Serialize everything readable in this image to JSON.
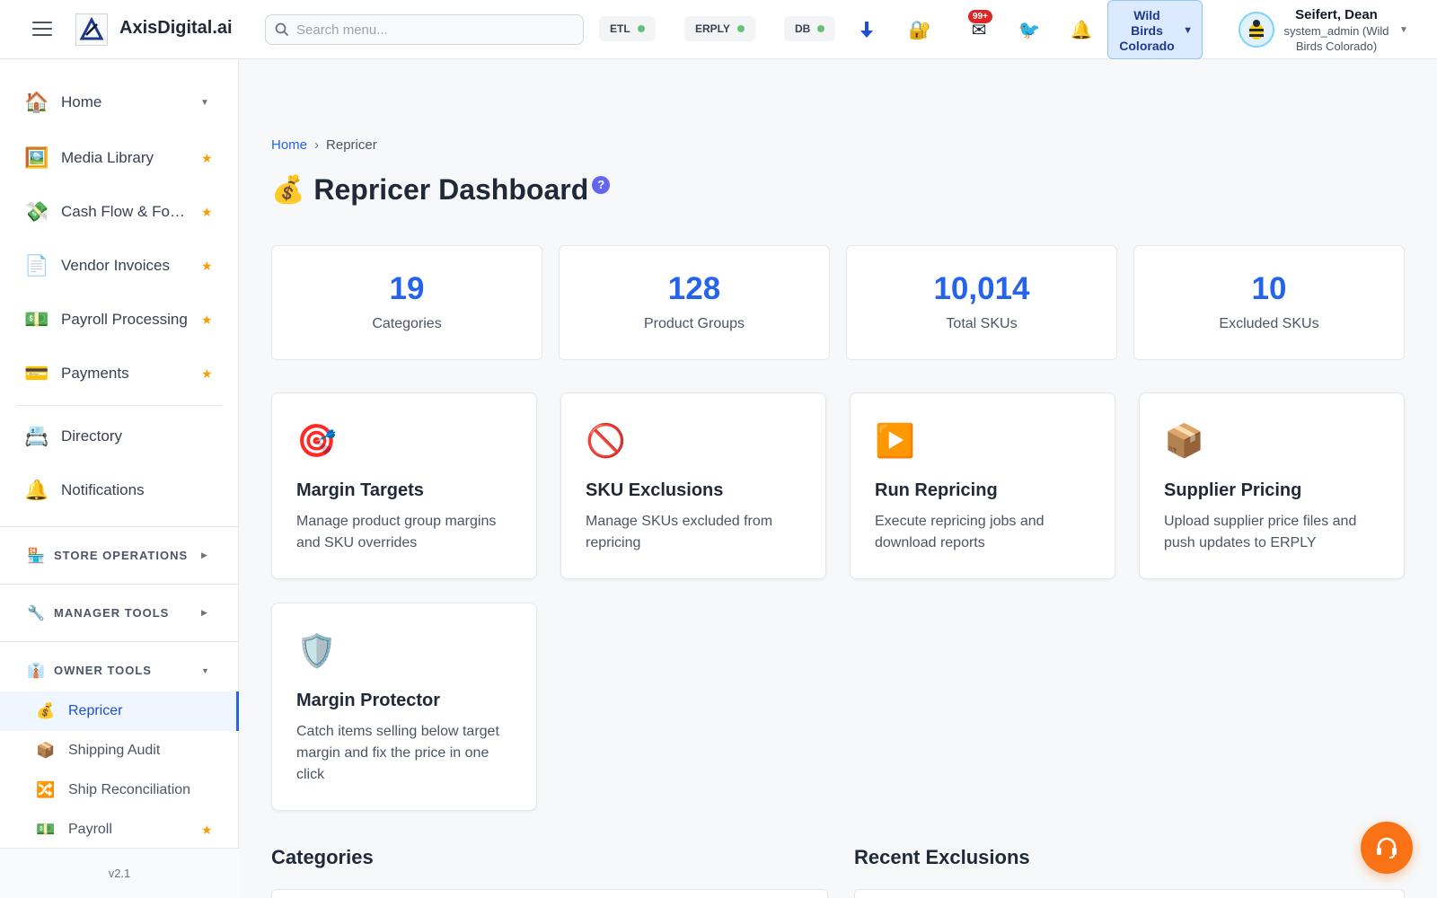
{
  "header": {
    "app_title": "AxisDigital.ai",
    "search_placeholder": "Search menu...",
    "status": [
      {
        "label": "ETL",
        "color": "#6ac07a"
      },
      {
        "label": "ERPLY",
        "color": "#6ac07a"
      },
      {
        "label": "DB",
        "color": "#6ac07a"
      }
    ],
    "icons": [
      "download-icon",
      "lock-icon",
      "mail-icon",
      "bird-icon",
      "bell-icon"
    ],
    "mail_badge": "99+",
    "store_line1": "Wild",
    "store_line2": "Birds",
    "store_line3": "Colorado",
    "user_name": "Seifert, Dean",
    "user_role_line1": "system_admin (Wild",
    "user_role_line2": "Birds Colorado)"
  },
  "sidebar": {
    "items": [
      {
        "label": "Home",
        "icon": "house-icon"
      },
      {
        "label": "Media Library",
        "icon": "picture-icon"
      },
      {
        "label": "Cash Flow & Forecast",
        "icon": "money-wings-icon"
      },
      {
        "label": "Vendor Invoices",
        "icon": "document-icon"
      },
      {
        "label": "Payroll Processing",
        "icon": "dollar-bill-icon"
      },
      {
        "label": "Payments",
        "icon": "credit-card-icon"
      },
      {
        "label": "Directory",
        "icon": "card-index-icon"
      },
      {
        "label": "Notifications",
        "icon": "bell-icon"
      }
    ],
    "sections": [
      {
        "label": "STORE OPERATIONS",
        "icon": "store-icon"
      },
      {
        "label": "MANAGER TOOLS",
        "icon": "wrench-icon"
      },
      {
        "label": "OWNER TOOLS",
        "icon": "necktie-icon"
      }
    ],
    "owner_items": [
      {
        "label": "Repricer",
        "icon": "money-bag-icon"
      },
      {
        "label": "Shipping Audit",
        "icon": "package-icon"
      },
      {
        "label": "Ship Reconciliation",
        "icon": "shuffle-icon"
      },
      {
        "label": "Payroll",
        "icon": "dollar-bill-icon"
      }
    ],
    "version": "v2.1"
  },
  "main": {
    "breadcrumb_home": "Home",
    "breadcrumb_current": "Repricer",
    "title": "Repricer Dashboard",
    "help": "?",
    "stats": [
      {
        "value": "19",
        "label": "Categories"
      },
      {
        "value": "128",
        "label": "Product Groups"
      },
      {
        "value": "10,014",
        "label": "Total SKUs"
      },
      {
        "value": "10",
        "label": "Excluded SKUs"
      }
    ],
    "cards": [
      {
        "title": "Margin Targets",
        "desc": "Manage product group margins and SKU overrides",
        "icon": "target-icon"
      },
      {
        "title": "SKU Exclusions",
        "desc": "Manage SKUs excluded from repricing",
        "icon": "prohibited-icon"
      },
      {
        "title": "Run Repricing",
        "desc": "Execute repricing jobs and download reports",
        "icon": "play-icon"
      },
      {
        "title": "Supplier Pricing",
        "desc": "Upload supplier price files and push updates to ERPLY",
        "icon": "package-icon"
      },
      {
        "title": "Margin Protector",
        "desc": "Catch items selling below target margin and fix the price in one click",
        "icon": "shield-icon"
      }
    ],
    "section_categories": "Categories",
    "section_recent": "Recent Exclusions"
  },
  "colors": {
    "accent": "#2563eb",
    "star": "#f59e0b",
    "fab": "#f97316",
    "badge": "#dc2626"
  }
}
